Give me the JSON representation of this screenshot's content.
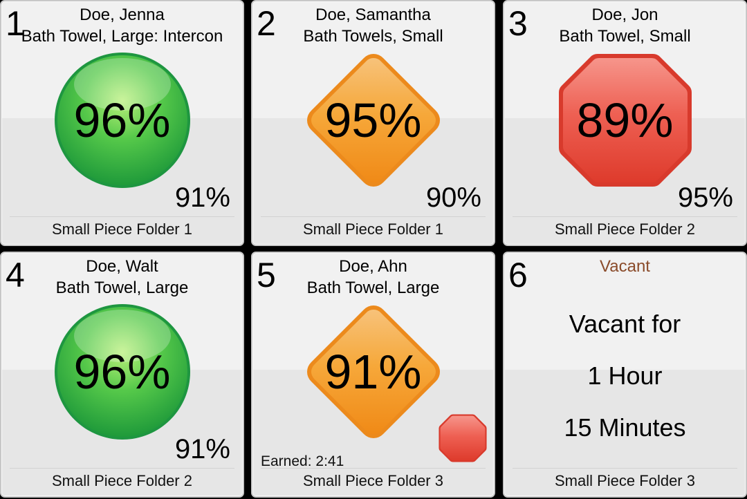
{
  "tiles": [
    {
      "number": "1",
      "name": "Doe, Jenna",
      "item": "Bath Towel, Large: Intercon",
      "percent": "96%",
      "sub_percent": "91%",
      "machine": "Small Piece Folder 1",
      "shape": "circle",
      "color": "#3fb34f"
    },
    {
      "number": "2",
      "name": "Doe, Samantha",
      "item": "Bath Towels, Small",
      "percent": "95%",
      "sub_percent": "90%",
      "machine": "Small Piece Folder 1",
      "shape": "diamond",
      "color": "#f59a23"
    },
    {
      "number": "3",
      "name": "Doe, Jon",
      "item": "Bath Towel, Small",
      "percent": "89%",
      "sub_percent": "95%",
      "machine": "Small Piece Folder 2",
      "shape": "octagon",
      "color": "#e4483a"
    },
    {
      "number": "4",
      "name": "Doe, Walt",
      "item": "Bath Towel, Large",
      "percent": "96%",
      "sub_percent": "91%",
      "machine": "Small Piece Folder 2",
      "shape": "circle",
      "color": "#3fb34f"
    },
    {
      "number": "5",
      "name": "Doe, Ahn",
      "item": "Bath Towel, Large",
      "percent": "91%",
      "earned": "Earned: 2:41",
      "machine": "Small Piece Folder 3",
      "shape": "diamond",
      "color": "#f59a23",
      "alert_icon": "stop-octagon-icon"
    },
    {
      "number": "6",
      "status": "Vacant",
      "vacant_lines": [
        "Vacant for",
        "1 Hour",
        "15 Minutes"
      ],
      "machine": "Small Piece Folder 3"
    }
  ]
}
